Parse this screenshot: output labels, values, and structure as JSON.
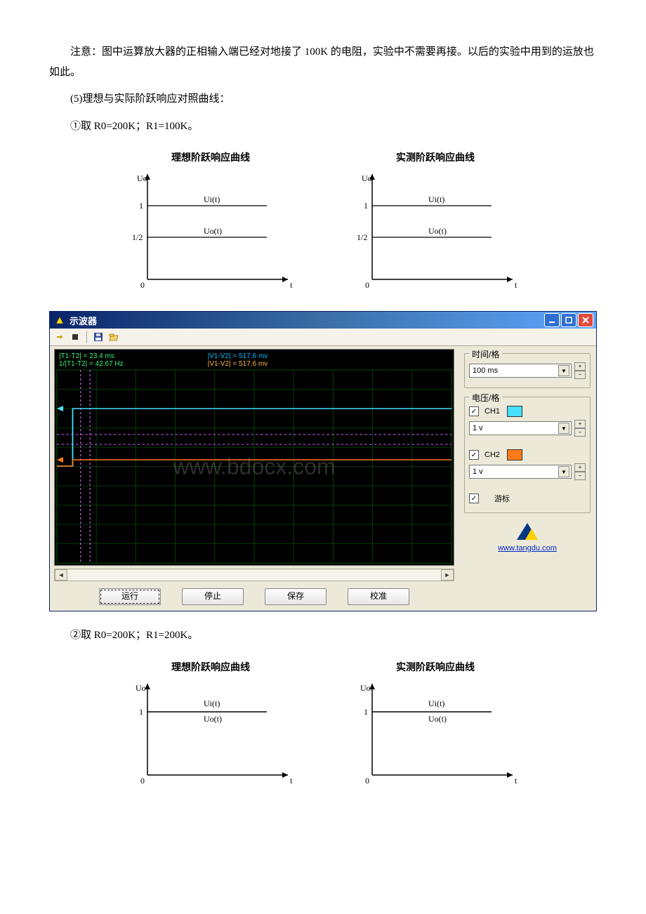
{
  "text": {
    "p1": "注意：图中运算放大器的正相输入端已经对地接了 100K 的电阻，实验中不需要再接。以后的实验中用到的运放也如此。",
    "p2": "(5)理想与实际阶跃响应对照曲线：",
    "p3": "①取 R0=200K；R1=100K。",
    "p4": "②取 R0=200K；R1=200K。"
  },
  "graphs": {
    "title_ideal": "理想阶跃响应曲线",
    "title_actual": "实测阶跃响应曲线",
    "y_axis": "Uo",
    "x_axis": "t",
    "y_tick_1": "1",
    "y_tick_half": "1/2",
    "y_tick_0": "0",
    "label_ui": "Ui(t)",
    "label_uo": "Uo(t)"
  },
  "oscilloscope": {
    "title": "示波器",
    "info_t1": "|T1-T2| = 23.4 ms",
    "info_t2": "1/|T1-T2| = 42.67 Hz",
    "info_v1": "|V1-V2| = 517.6 mv",
    "info_v2": "|V1-V2| = 517.6 mv",
    "watermark": "www.bdocx.com",
    "buttons": {
      "run": "运行",
      "stop": "停止",
      "save": "保存",
      "cal": "校准"
    },
    "group_time": "时间/格",
    "group_volt": "电压/格",
    "time_value": "100 ms",
    "ch1_label": "CH1",
    "ch2_label": "CH2",
    "volt_value": "1 v",
    "ch1_color": "#46e0ff",
    "ch2_color": "#ff7a1a",
    "cursor_label": "游标",
    "link": "www.tangdu.com"
  },
  "chart_data": [
    {
      "type": "line",
      "title": "理想阶跃响应曲线",
      "case": "R0=200K, R1=100K",
      "xlabel": "t",
      "ylabel": "Uo",
      "y_ticks": [
        0,
        0.5,
        1
      ],
      "series": [
        {
          "name": "Ui(t)",
          "type": "step",
          "y": 1
        },
        {
          "name": "Uo(t)",
          "type": "step",
          "y": 0.5
        }
      ]
    },
    {
      "type": "line",
      "title": "实测阶跃响应曲线",
      "case": "R0=200K, R1=100K",
      "xlabel": "t",
      "ylabel": "Uo",
      "y_ticks": [
        0,
        0.5,
        1
      ],
      "series": [
        {
          "name": "Ui(t)",
          "type": "step",
          "y": 1
        },
        {
          "name": "Uo(t)",
          "type": "step",
          "y": 0.5
        }
      ]
    },
    {
      "type": "line",
      "title": "Oscilloscope capture",
      "time_per_div": "100 ms",
      "volt_per_div": "1 v",
      "measurements": {
        "dt_ms": 23.4,
        "freq_hz": 42.67,
        "dv_mv": 517.6
      },
      "series": [
        {
          "name": "CH1",
          "color": "#46e0ff",
          "description": "step input ≈1V"
        },
        {
          "name": "CH2",
          "color": "#ff7a1a",
          "description": "step response ≈0.5V"
        }
      ]
    },
    {
      "type": "line",
      "title": "理想阶跃响应曲线",
      "case": "R0=200K, R1=200K",
      "xlabel": "t",
      "ylabel": "Uo",
      "y_ticks": [
        0,
        1
      ],
      "series": [
        {
          "name": "Ui(t)",
          "type": "step",
          "y": 1
        },
        {
          "name": "Uo(t)",
          "type": "step",
          "y": 1
        }
      ]
    },
    {
      "type": "line",
      "title": "实测阶跃响应曲线",
      "case": "R0=200K, R1=200K",
      "xlabel": "t",
      "ylabel": "Uo",
      "y_ticks": [
        0,
        1
      ],
      "series": [
        {
          "name": "Ui(t)",
          "type": "step",
          "y": 1
        },
        {
          "name": "Uo(t)",
          "type": "step",
          "y": 1
        }
      ]
    }
  ]
}
